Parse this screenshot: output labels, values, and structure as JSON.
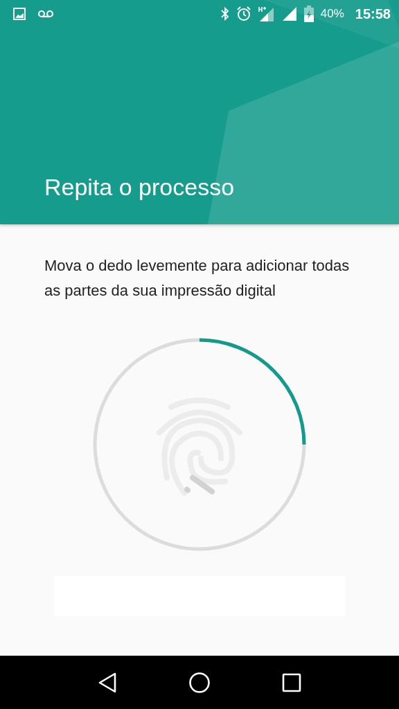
{
  "status_bar": {
    "battery": "40%",
    "time": "15:58"
  },
  "header": {
    "title": "Repita o processo"
  },
  "instructions": "Mova o dedo levemente para adicionar todas as partes da sua impressão digital",
  "progress": {
    "level": 0.25
  }
}
